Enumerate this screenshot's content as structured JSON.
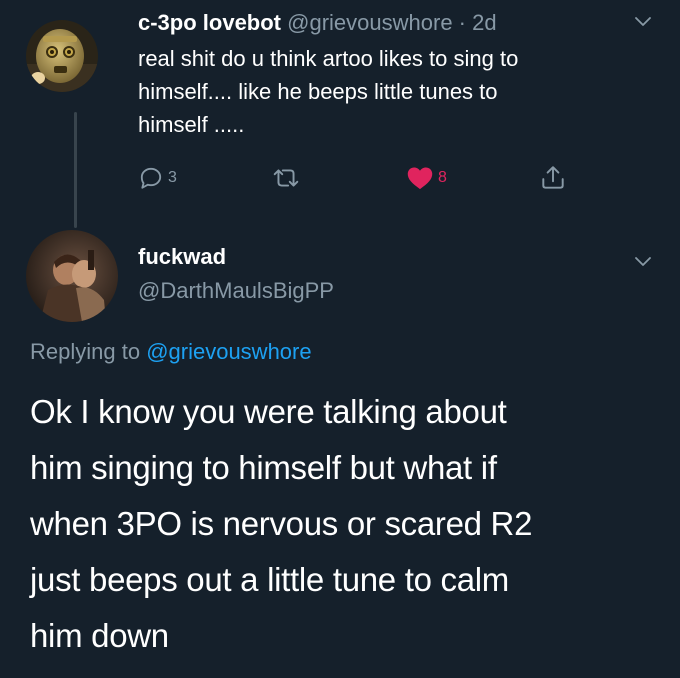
{
  "tweet1": {
    "display_name": "c-3po lovebot",
    "handle": "@grievouswhore",
    "separator": " · ",
    "time": "2d",
    "text_lines": [
      "real shit do u think artoo likes to sing to",
      "himself.... like he beeps little tunes to",
      "himself ....."
    ],
    "reply_count": "3",
    "like_count": "8",
    "colors": {
      "like": "#e0245e",
      "icon": "#8899a6"
    }
  },
  "tweet2": {
    "display_name": "fuckwad",
    "handle": "@DarthMaulsBigPP",
    "replying_prefix": "Replying to ",
    "replying_to": "@grievouswhore",
    "text_lines": [
      "Ok I know you were talking about",
      "him singing to himself but what if",
      "when 3PO is nervous or scared R2",
      "just beeps out a little tune to calm",
      "him down"
    ]
  },
  "theme": {
    "background": "#15202b",
    "secondary_text": "#8899a6",
    "link": "#1da1f2"
  }
}
